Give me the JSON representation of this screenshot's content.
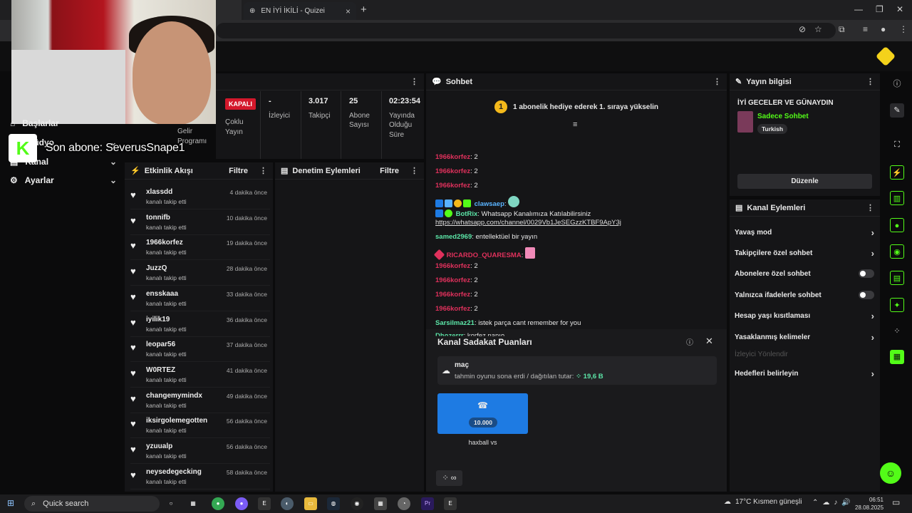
{
  "browser": {
    "tab_title": "EN İYİ İKİLİ - Quizei",
    "new_tab": "+"
  },
  "sub_banner": {
    "logo": "K",
    "text": "Son abone: SeverusSnape1"
  },
  "sidebar": {
    "items": [
      {
        "label": "Başlarlar",
        "icon": "home-icon"
      },
      {
        "label": "Stüdyo",
        "icon": "studio-icon"
      },
      {
        "label": "Kanal",
        "icon": "channel-icon"
      },
      {
        "label": "Ayarlar",
        "icon": "gear-icon"
      }
    ]
  },
  "stats": {
    "status_badge": "KAPALI",
    "gelir": "Gelir Programı",
    "coklu": "Çoklu Yayın",
    "viewers_value": "-",
    "viewers_label": "İzleyici",
    "followers_value": "3.017",
    "followers_label": "Takipçi",
    "subs_value": "25",
    "subs_label": "Abone Sayısı",
    "uptime_value": "02:23:54",
    "uptime_label": "Yayında Olduğu Süre"
  },
  "feed": {
    "title": "Etkinlik Akışı",
    "filter": "Filtre",
    "items": [
      {
        "name": "xlassdd",
        "action": "kanalı takip etti",
        "time": "4 dakika önce"
      },
      {
        "name": "tonnifb",
        "action": "kanalı takip etti",
        "time": "10 dakika önce"
      },
      {
        "name": "1966korfez",
        "action": "kanalı takip etti",
        "time": "19 dakika önce"
      },
      {
        "name": "JuzzQ",
        "action": "kanalı takip etti",
        "time": "28 dakika önce"
      },
      {
        "name": "ensskaaa",
        "action": "kanalı takip etti",
        "time": "33 dakika önce"
      },
      {
        "name": "iyilik19",
        "action": "kanalı takip etti",
        "time": "36 dakika önce"
      },
      {
        "name": "leopar56",
        "action": "kanalı takip etti",
        "time": "37 dakika önce"
      },
      {
        "name": "W0RTEZ",
        "action": "kanalı takip etti",
        "time": "41 dakika önce"
      },
      {
        "name": "changemymindx",
        "action": "kanalı takip etti",
        "time": "49 dakika önce"
      },
      {
        "name": "iksirgolemegotten",
        "action": "kanalı takip etti",
        "time": "56 dakika önce"
      },
      {
        "name": "yzuualp",
        "action": "kanalı takip etti",
        "time": "56 dakika önce"
      },
      {
        "name": "neysedegecking",
        "action": "kanalı takip etti",
        "time": "58 dakika önce"
      }
    ]
  },
  "mod": {
    "title": "Denetim Eylemleri",
    "filter": "Filtre"
  },
  "chat": {
    "title": "Sohbet",
    "pinned_badge": "1",
    "pinned_text": "1 abonelik hediye ederek 1. sıraya yükselin",
    "messages": [
      {
        "user": "1966korfez",
        "text": ": 2"
      },
      {
        "user": "1966korfez",
        "text": ": 2"
      },
      {
        "user": "1966korfez",
        "text": ": 2"
      },
      {
        "user": "clawsaep",
        "text": ":"
      },
      {
        "user": "BotRix",
        "text": ": Whatsapp Kanalımıza Katılabilirsiniz"
      },
      {
        "user": "",
        "text": "https://whatsapp.com/channel/0029Vb1JeSEGzzKTBF9ApY3j"
      },
      {
        "user": "samed2969",
        "text": ": entellektüel bir yayın"
      },
      {
        "user": "RICARDO_QUARESMA",
        "text": ":"
      },
      {
        "user": "1966korfez",
        "text": ": 2"
      },
      {
        "user": "1966korfez",
        "text": ": 2"
      },
      {
        "user": "1966korfez",
        "text": ": 2"
      },
      {
        "user": "1966korfez",
        "text": ": 2"
      },
      {
        "user": "Sarsilmaz21",
        "text": ": istek parça cant remember for you"
      },
      {
        "user": "Dhozerrr",
        "text": ": korfez napıo"
      }
    ]
  },
  "loyalty": {
    "title": "Kanal Sadakat Puanları",
    "prediction_title": "maç",
    "prediction_text": "tahmin oyunu sona erdi / dağıtılan tutar: ",
    "prediction_amount": "19,6 B",
    "reward_price": "10.000",
    "reward_label": "haxball vs",
    "points": "∞"
  },
  "stream_info": {
    "title": "Yayın bilgisi",
    "stream_title": "İYİ GECELER VE GÜNAYDIN",
    "category": "Sadece Sohbet",
    "tag": "Turkish",
    "edit_button": "Düzenle"
  },
  "channel_actions": {
    "title": "Kanal Eylemleri",
    "items": [
      {
        "label": "Yavaş mod",
        "kind": "chevron"
      },
      {
        "label": "Takipçilere özel sohbet",
        "kind": "chevron"
      },
      {
        "label": "Abonelere özel sohbet",
        "kind": "toggle"
      },
      {
        "label": "Yalnızca ifadelerle sohbet",
        "kind": "toggle"
      },
      {
        "label": "Hesap yaşı kısıtlaması",
        "kind": "chevron"
      },
      {
        "label": "Yasaklanmış kelimeler",
        "kind": "chevron"
      },
      {
        "label": "İzleyici Yönlendir",
        "kind": "disabled"
      },
      {
        "label": "Hedefleri belirleyin",
        "kind": "chevron"
      }
    ]
  },
  "taskbar": {
    "search": "Quick search",
    "weather": "17°C  Kısmen güneşli",
    "time": "06:51",
    "date": "28.08.2025"
  },
  "colors": {
    "accent": "#53fc18",
    "badge_red": "#d4182b",
    "reward_blue": "#1e7be3"
  }
}
